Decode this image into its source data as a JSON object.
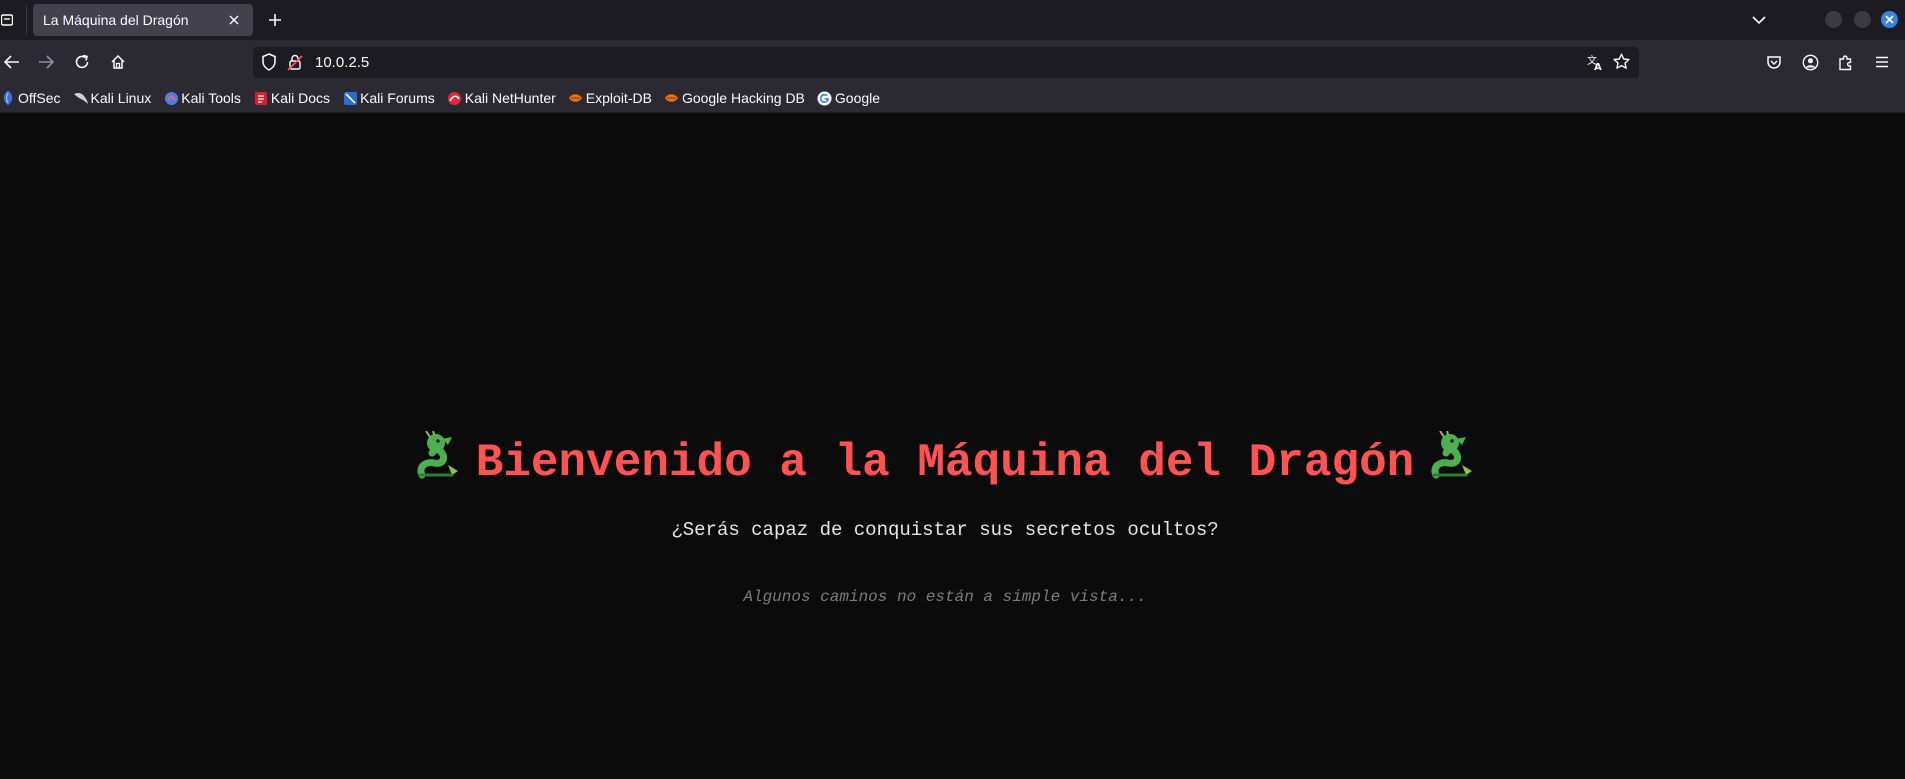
{
  "browser": {
    "tab": {
      "title": "La Máquina del Dragón",
      "close_icon": "close-icon"
    },
    "new_tab_icon": "plus-icon",
    "url": "10.0.2.5",
    "toolbar_icons": [
      "back-arrow-icon",
      "forward-arrow-icon",
      "reload-icon",
      "home-icon",
      "shield-icon",
      "lock-warning-icon",
      "translate-icon",
      "star-icon",
      "pocket-icon",
      "account-icon",
      "extensions-icon",
      "menu-icon"
    ]
  },
  "bookmarks": [
    {
      "label": "OffSec",
      "icon": "offsec-icon"
    },
    {
      "label": "Kali Linux",
      "icon": "kali-dragon-icon"
    },
    {
      "label": "Kali Tools",
      "icon": "kali-tools-icon"
    },
    {
      "label": "Kali Docs",
      "icon": "kali-docs-icon"
    },
    {
      "label": "Kali Forums",
      "icon": "kali-forums-icon"
    },
    {
      "label": "Kali NetHunter",
      "icon": "nethunter-icon"
    },
    {
      "label": "Exploit-DB",
      "icon": "exploit-db-icon"
    },
    {
      "label": "Google Hacking DB",
      "icon": "ghdb-icon"
    },
    {
      "label": "Google",
      "icon": "google-icon"
    }
  ],
  "page": {
    "heading": "Bienvenido a la Máquina del Dragón",
    "subtitle": "¿Serás capaz de conquistar sus secretos ocultos?",
    "hint": "Algunos caminos no están a simple vista...",
    "accent_color": "#ff5252",
    "background_color": "#0b0b0c"
  }
}
